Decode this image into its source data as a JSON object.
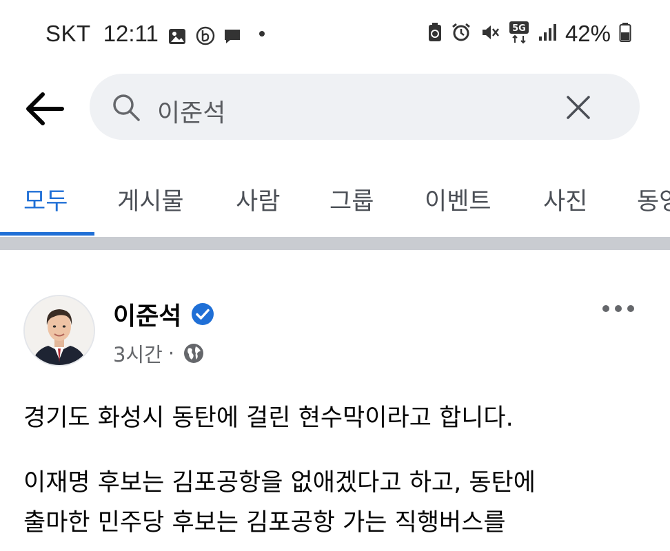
{
  "status_bar": {
    "carrier": "SKT",
    "time": "12:11",
    "network": "5G",
    "battery": "42%",
    "left_icons": [
      "gallery-icon",
      "b-app-icon",
      "message-icon",
      "more-dot-icon"
    ],
    "right_icons": [
      "recycle-battery-icon",
      "alarm-icon",
      "mute-icon",
      "5g-icon",
      "signal-icon",
      "battery-icon"
    ]
  },
  "search": {
    "query": "이준석"
  },
  "tabs": [
    {
      "label": "모두",
      "active": true
    },
    {
      "label": "게시물",
      "active": false
    },
    {
      "label": "사람",
      "active": false
    },
    {
      "label": "그룹",
      "active": false
    },
    {
      "label": "이벤트",
      "active": false
    },
    {
      "label": "사진",
      "active": false
    },
    {
      "label": "동영",
      "active": false
    }
  ],
  "post": {
    "author": "이준석",
    "verified": true,
    "time": "3시간",
    "separator": "·",
    "privacy": "public",
    "lines": [
      "경기도 화성시 동탄에 걸린 현수막이라고 합니다.",
      "이재명 후보는 김포공항을 없애겠다고 하고, 동탄에",
      "출마한 민주당 후보는 김포공항 가는 직행버스를"
    ]
  },
  "colors": {
    "accent": "#1f6fd6",
    "search_bg": "#eff1f4",
    "divider": "#c9ccd1",
    "secondary_text": "#65676b"
  }
}
